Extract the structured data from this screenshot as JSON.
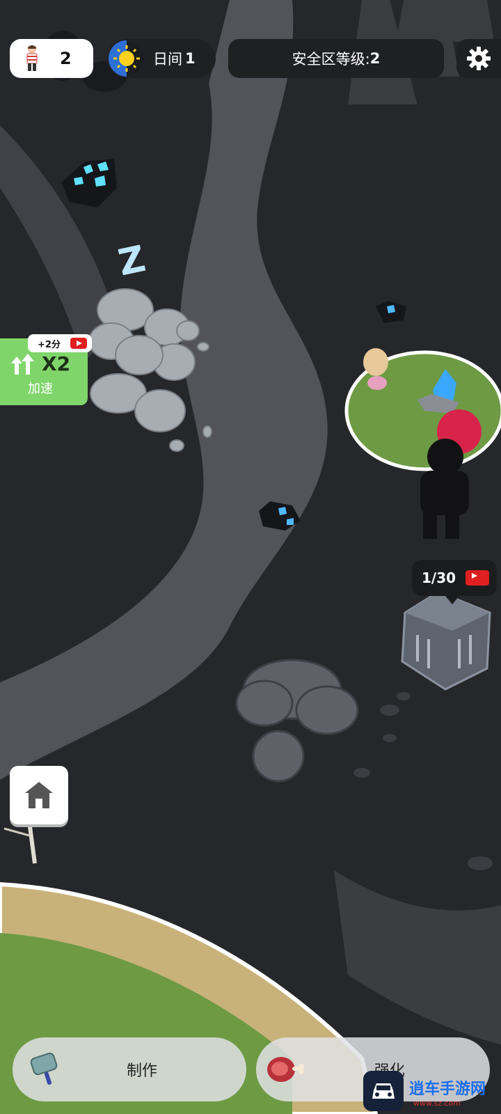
{
  "hud": {
    "player_count": "2",
    "day_label": "日间",
    "day_number": "1",
    "safe_zone_label": "安全区等级:",
    "safe_zone_level": "2"
  },
  "speed_boost": {
    "bonus": "+2分",
    "multiplier": "X2",
    "label": "加速"
  },
  "collector": {
    "progress": "1/30"
  },
  "bottom_bar": {
    "craft_label": "制作",
    "upgrade_label": "强化"
  },
  "watermark": {
    "site": "逍车手游网",
    "url": "www.sz.com"
  },
  "colors": {
    "terrain": "#2a2b2e",
    "river": "#5a5d63",
    "grass": "#6e9a44",
    "sand": "#c9b27a",
    "speed_green": "#7fd56a",
    "crystal_blue": "#3aa8ff",
    "yt_red": "#e02020"
  },
  "icons": [
    "player-icon",
    "sun-icon",
    "gear-icon",
    "up-arrows-icon",
    "youtube-icon",
    "home-icon",
    "pan-icon",
    "meat-icon"
  ]
}
